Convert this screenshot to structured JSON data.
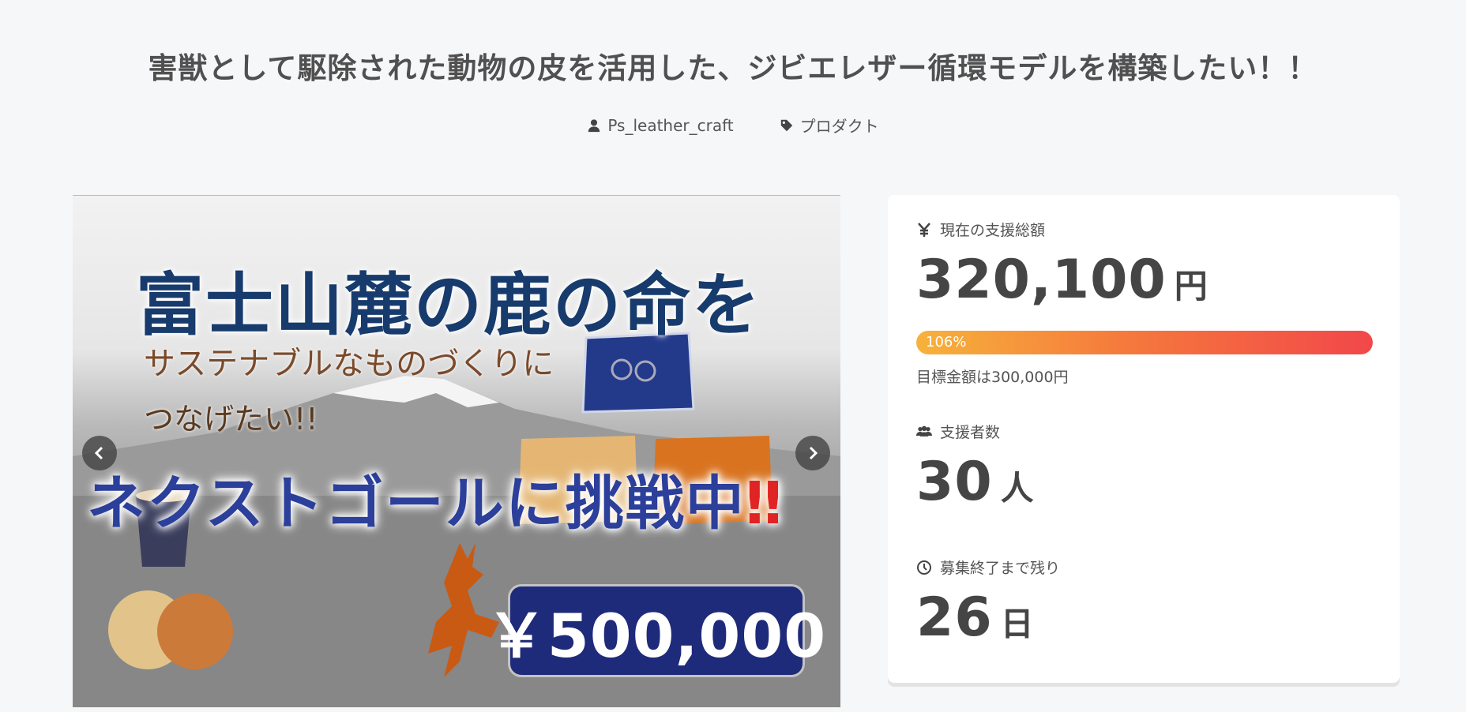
{
  "project": {
    "title": "害獣として駆除された動物の皮を活用した、ジビエレザー循環モデルを構築したい！！",
    "owner": "Ps_leather_craft",
    "category": "プロダクト"
  },
  "hero": {
    "line1": "富士山麓の鹿の命を",
    "line2": "サステナブルなものづくりに",
    "line3": "つなげたい!!",
    "line4": "ネクストゴールに挑戦中",
    "line4_mark": "‼",
    "price": "￥500,000"
  },
  "stats": {
    "total_label": "現在の支援総額",
    "total_value": "320,100",
    "total_unit": "円",
    "progress_label": "106%",
    "progress_percent": 106,
    "goal_text": "目標金額は300,000円",
    "backers_label": "支援者数",
    "backers_value": "30",
    "backers_unit": "人",
    "remaining_label": "募集終了まで残り",
    "remaining_value": "26",
    "remaining_unit": "日"
  },
  "icons": {
    "owner": "user-icon",
    "category": "tag-icon",
    "total": "yen-icon",
    "backers": "users-icon",
    "remaining": "clock-icon",
    "prev": "chevron-left-icon",
    "next": "chevron-right-icon"
  },
  "colors": {
    "progress_start": "#f7b23b",
    "progress_end": "#f2474a",
    "price_box": "#1e2a7a"
  }
}
